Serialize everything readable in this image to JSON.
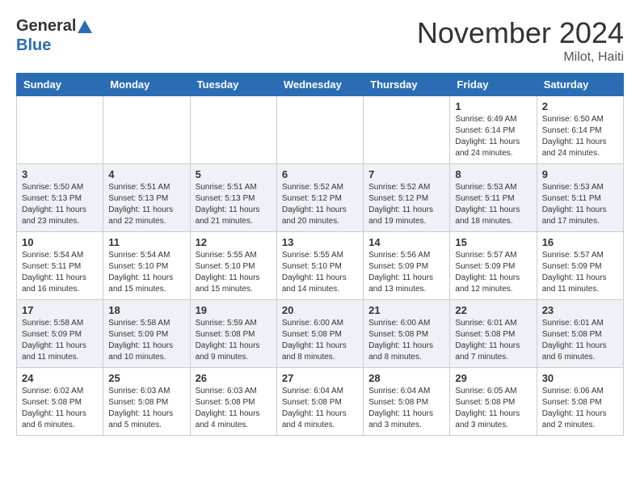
{
  "header": {
    "logo_line1": "General",
    "logo_line2": "Blue",
    "month": "November 2024",
    "location": "Milot, Haiti"
  },
  "weekdays": [
    "Sunday",
    "Monday",
    "Tuesday",
    "Wednesday",
    "Thursday",
    "Friday",
    "Saturday"
  ],
  "weeks": [
    [
      {
        "day": "",
        "sunrise": "",
        "sunset": "",
        "daylight": ""
      },
      {
        "day": "",
        "sunrise": "",
        "sunset": "",
        "daylight": ""
      },
      {
        "day": "",
        "sunrise": "",
        "sunset": "",
        "daylight": ""
      },
      {
        "day": "",
        "sunrise": "",
        "sunset": "",
        "daylight": ""
      },
      {
        "day": "",
        "sunrise": "",
        "sunset": "",
        "daylight": ""
      },
      {
        "day": "1",
        "sunrise": "Sunrise: 6:49 AM",
        "sunset": "Sunset: 6:14 PM",
        "daylight": "Daylight: 11 hours and 24 minutes."
      },
      {
        "day": "2",
        "sunrise": "Sunrise: 6:50 AM",
        "sunset": "Sunset: 6:14 PM",
        "daylight": "Daylight: 11 hours and 24 minutes."
      }
    ],
    [
      {
        "day": "3",
        "sunrise": "Sunrise: 5:50 AM",
        "sunset": "Sunset: 5:13 PM",
        "daylight": "Daylight: 11 hours and 23 minutes."
      },
      {
        "day": "4",
        "sunrise": "Sunrise: 5:51 AM",
        "sunset": "Sunset: 5:13 PM",
        "daylight": "Daylight: 11 hours and 22 minutes."
      },
      {
        "day": "5",
        "sunrise": "Sunrise: 5:51 AM",
        "sunset": "Sunset: 5:13 PM",
        "daylight": "Daylight: 11 hours and 21 minutes."
      },
      {
        "day": "6",
        "sunrise": "Sunrise: 5:52 AM",
        "sunset": "Sunset: 5:12 PM",
        "daylight": "Daylight: 11 hours and 20 minutes."
      },
      {
        "day": "7",
        "sunrise": "Sunrise: 5:52 AM",
        "sunset": "Sunset: 5:12 PM",
        "daylight": "Daylight: 11 hours and 19 minutes."
      },
      {
        "day": "8",
        "sunrise": "Sunrise: 5:53 AM",
        "sunset": "Sunset: 5:11 PM",
        "daylight": "Daylight: 11 hours and 18 minutes."
      },
      {
        "day": "9",
        "sunrise": "Sunrise: 5:53 AM",
        "sunset": "Sunset: 5:11 PM",
        "daylight": "Daylight: 11 hours and 17 minutes."
      }
    ],
    [
      {
        "day": "10",
        "sunrise": "Sunrise: 5:54 AM",
        "sunset": "Sunset: 5:11 PM",
        "daylight": "Daylight: 11 hours and 16 minutes."
      },
      {
        "day": "11",
        "sunrise": "Sunrise: 5:54 AM",
        "sunset": "Sunset: 5:10 PM",
        "daylight": "Daylight: 11 hours and 15 minutes."
      },
      {
        "day": "12",
        "sunrise": "Sunrise: 5:55 AM",
        "sunset": "Sunset: 5:10 PM",
        "daylight": "Daylight: 11 hours and 15 minutes."
      },
      {
        "day": "13",
        "sunrise": "Sunrise: 5:55 AM",
        "sunset": "Sunset: 5:10 PM",
        "daylight": "Daylight: 11 hours and 14 minutes."
      },
      {
        "day": "14",
        "sunrise": "Sunrise: 5:56 AM",
        "sunset": "Sunset: 5:09 PM",
        "daylight": "Daylight: 11 hours and 13 minutes."
      },
      {
        "day": "15",
        "sunrise": "Sunrise: 5:57 AM",
        "sunset": "Sunset: 5:09 PM",
        "daylight": "Daylight: 11 hours and 12 minutes."
      },
      {
        "day": "16",
        "sunrise": "Sunrise: 5:57 AM",
        "sunset": "Sunset: 5:09 PM",
        "daylight": "Daylight: 11 hours and 11 minutes."
      }
    ],
    [
      {
        "day": "17",
        "sunrise": "Sunrise: 5:58 AM",
        "sunset": "Sunset: 5:09 PM",
        "daylight": "Daylight: 11 hours and 11 minutes."
      },
      {
        "day": "18",
        "sunrise": "Sunrise: 5:58 AM",
        "sunset": "Sunset: 5:09 PM",
        "daylight": "Daylight: 11 hours and 10 minutes."
      },
      {
        "day": "19",
        "sunrise": "Sunrise: 5:59 AM",
        "sunset": "Sunset: 5:08 PM",
        "daylight": "Daylight: 11 hours and 9 minutes."
      },
      {
        "day": "20",
        "sunrise": "Sunrise: 6:00 AM",
        "sunset": "Sunset: 5:08 PM",
        "daylight": "Daylight: 11 hours and 8 minutes."
      },
      {
        "day": "21",
        "sunrise": "Sunrise: 6:00 AM",
        "sunset": "Sunset: 5:08 PM",
        "daylight": "Daylight: 11 hours and 8 minutes."
      },
      {
        "day": "22",
        "sunrise": "Sunrise: 6:01 AM",
        "sunset": "Sunset: 5:08 PM",
        "daylight": "Daylight: 11 hours and 7 minutes."
      },
      {
        "day": "23",
        "sunrise": "Sunrise: 6:01 AM",
        "sunset": "Sunset: 5:08 PM",
        "daylight": "Daylight: 11 hours and 6 minutes."
      }
    ],
    [
      {
        "day": "24",
        "sunrise": "Sunrise: 6:02 AM",
        "sunset": "Sunset: 5:08 PM",
        "daylight": "Daylight: 11 hours and 6 minutes."
      },
      {
        "day": "25",
        "sunrise": "Sunrise: 6:03 AM",
        "sunset": "Sunset: 5:08 PM",
        "daylight": "Daylight: 11 hours and 5 minutes."
      },
      {
        "day": "26",
        "sunrise": "Sunrise: 6:03 AM",
        "sunset": "Sunset: 5:08 PM",
        "daylight": "Daylight: 11 hours and 4 minutes."
      },
      {
        "day": "27",
        "sunrise": "Sunrise: 6:04 AM",
        "sunset": "Sunset: 5:08 PM",
        "daylight": "Daylight: 11 hours and 4 minutes."
      },
      {
        "day": "28",
        "sunrise": "Sunrise: 6:04 AM",
        "sunset": "Sunset: 5:08 PM",
        "daylight": "Daylight: 11 hours and 3 minutes."
      },
      {
        "day": "29",
        "sunrise": "Sunrise: 6:05 AM",
        "sunset": "Sunset: 5:08 PM",
        "daylight": "Daylight: 11 hours and 3 minutes."
      },
      {
        "day": "30",
        "sunrise": "Sunrise: 6:06 AM",
        "sunset": "Sunset: 5:08 PM",
        "daylight": "Daylight: 11 hours and 2 minutes."
      }
    ]
  ]
}
